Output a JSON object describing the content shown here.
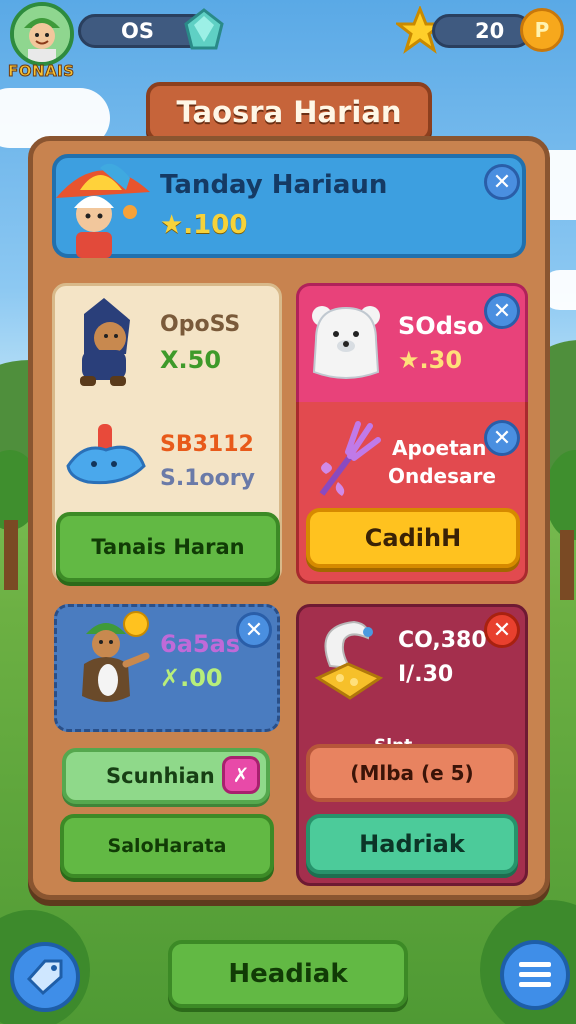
{
  "top_bar": {
    "player_name": "FONAIS",
    "gems": "OS",
    "stars": "20",
    "coin_symbol": "P"
  },
  "title": "Taosra Harian",
  "header_card": {
    "title": "Tanday Hariaun",
    "reward": "★.100"
  },
  "cards": {
    "task1": {
      "name": "OpoSS",
      "value": "X.50"
    },
    "task2": {
      "name": "SB3112",
      "value": "S.1oory"
    },
    "task3": {
      "name": "SOdso",
      "value": "★.30"
    },
    "task4": {
      "name": "Apoetan",
      "sub": "Ondesare"
    },
    "task5": {
      "name": "6a5as",
      "value": "✗.00"
    },
    "task6": {
      "name": "CO,380",
      "value": "I/.30"
    }
  },
  "buttons": {
    "tanais": "Tanais Haran",
    "cadih": "CadihH",
    "scunhian": "Scunhian",
    "salo": "SaloHarata",
    "slnt_title": "Slnt",
    "slnt_value": "(Mlba (e 5)",
    "hadriak": "Hadriak",
    "bottom": "Headiak"
  },
  "colors": {
    "panel": "#c8834f",
    "header": "#3d9fe0",
    "pink_card": "#e8427a",
    "red_card": "#e24a4f",
    "blue_card": "#4a7cc0",
    "maroon_card": "#a42f4d"
  }
}
